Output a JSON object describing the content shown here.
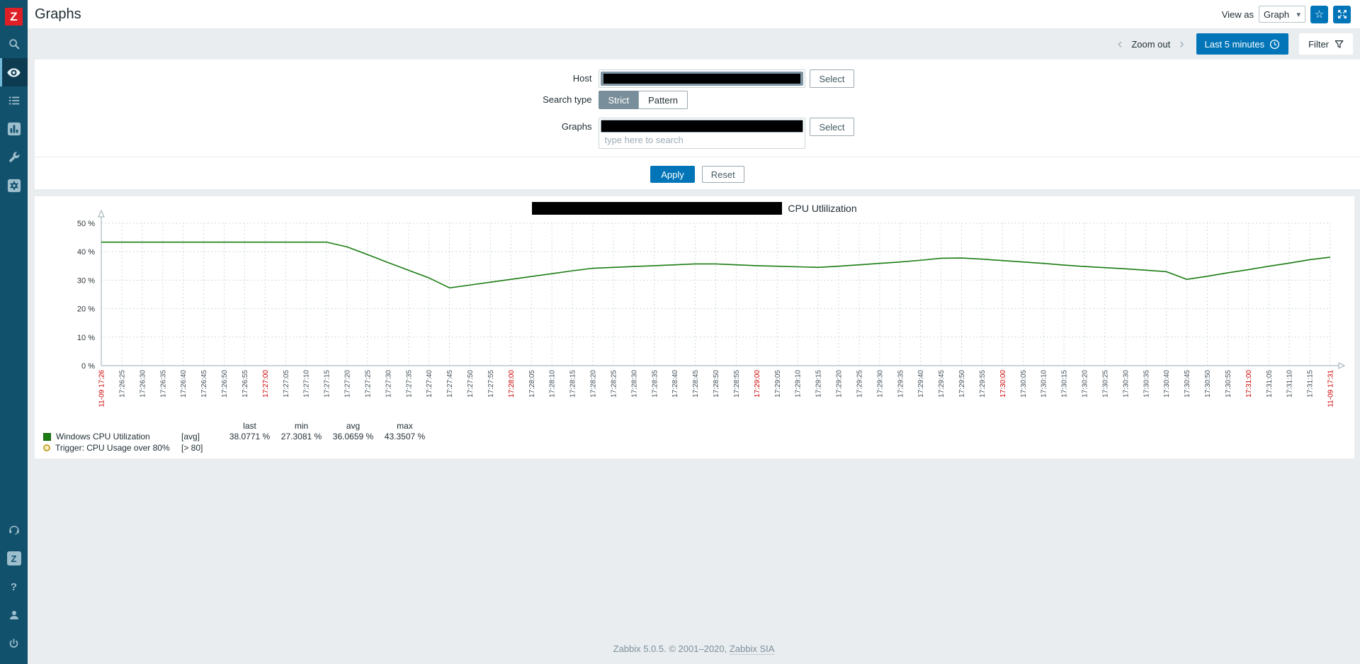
{
  "icons": {
    "logo_letter": "Z",
    "share_letter": "Z",
    "question_mark": "?",
    "star": "☆",
    "chevron_left": "‹",
    "chevron_right": "›",
    "caret_down": "▾"
  },
  "header": {
    "title": "Graphs",
    "view_as_label": "View as",
    "view_as_value": "Graph"
  },
  "timebar": {
    "zoom_out_label": "Zoom out",
    "time_range_label": "Last 5 minutes",
    "filter_tab_label": "Filter"
  },
  "filter": {
    "host_label": "Host",
    "host_value_redacted": true,
    "host_select_label": "Select",
    "search_type_label": "Search type",
    "search_type_options": [
      "Strict",
      "Pattern"
    ],
    "search_type_selected": "Strict",
    "graphs_label": "Graphs",
    "graphs_value_redacted": true,
    "graphs_placeholder": "type here to search",
    "graphs_select_label": "Select",
    "apply_label": "Apply",
    "reset_label": "Reset"
  },
  "chart_data": {
    "type": "line",
    "title": "CPU Utlilization",
    "title_prefix_redacted": true,
    "ylabel": "",
    "ylim": [
      0,
      50
    ],
    "yticks": [
      "0 %",
      "10 %",
      "20 %",
      "30 %",
      "40 %",
      "50 %"
    ],
    "grid": true,
    "x_labels": [
      "11-09 17:26",
      "17:26:25",
      "17:26:30",
      "17:26:35",
      "17:26:40",
      "17:26:45",
      "17:26:50",
      "17:26:55",
      "17:27:00",
      "17:27:05",
      "17:27:10",
      "17:27:15",
      "17:27:20",
      "17:27:25",
      "17:27:30",
      "17:27:35",
      "17:27:40",
      "17:27:45",
      "17:27:50",
      "17:27:55",
      "17:28:00",
      "17:28:05",
      "17:28:10",
      "17:28:15",
      "17:28:20",
      "17:28:25",
      "17:28:30",
      "17:28:35",
      "17:28:40",
      "17:28:45",
      "17:28:50",
      "17:28:55",
      "17:29:00",
      "17:29:05",
      "17:29:10",
      "17:29:15",
      "17:29:20",
      "17:29:25",
      "17:29:30",
      "17:29:35",
      "17:29:40",
      "17:29:45",
      "17:29:50",
      "17:29:55",
      "17:30:00",
      "17:30:05",
      "17:30:10",
      "17:30:15",
      "17:30:20",
      "17:30:25",
      "17:30:30",
      "17:30:35",
      "17:30:40",
      "17:30:45",
      "17:30:50",
      "17:30:55",
      "17:31:00",
      "17:31:05",
      "17:31:10",
      "17:31:15",
      "11-09 17:31"
    ],
    "red_label_indices": [
      0,
      8,
      20,
      32,
      44,
      56,
      60
    ],
    "series": [
      {
        "name": "Windows CPU Utilization",
        "color": "#1a7c11",
        "values": [
          43.35,
          43.35,
          43.35,
          43.35,
          43.35,
          43.35,
          43.35,
          43.35,
          43.35,
          43.35,
          43.35,
          43.35,
          41.7,
          39.0,
          36.2,
          33.5,
          30.8,
          27.31,
          28.3,
          29.3,
          30.3,
          31.3,
          32.3,
          33.3,
          34.2,
          34.5,
          34.8,
          35.1,
          35.4,
          35.7,
          35.7,
          35.4,
          35.1,
          34.9,
          34.7,
          34.5,
          34.9,
          35.4,
          35.9,
          36.4,
          37.0,
          37.7,
          37.8,
          37.4,
          36.9,
          36.4,
          35.9,
          35.3,
          34.8,
          34.4,
          34.0,
          33.5,
          33.0,
          30.3,
          31.4,
          32.6,
          33.7,
          34.9,
          36.0,
          37.2,
          38.08
        ]
      }
    ],
    "legend": {
      "headers": [
        "last",
        "min",
        "avg",
        "max"
      ],
      "rows": [
        {
          "name": "Windows CPU Utilization",
          "function": "[avg]",
          "last": "38.0771 %",
          "min": "27.3081 %",
          "avg": "36.0659 %",
          "max": "43.3507 %"
        }
      ],
      "trigger": {
        "name": "Trigger: CPU Usage over 80%",
        "condition": "[> 80]"
      }
    },
    "colors": {
      "grid": "#cfd9de",
      "axis": "#9aaab3",
      "tick_label": "#43505a",
      "tick_label_red": "#cc0000"
    }
  },
  "footer": {
    "text": "Zabbix 5.0.5. © 2001–2020, ",
    "link_text": "Zabbix SIA"
  }
}
